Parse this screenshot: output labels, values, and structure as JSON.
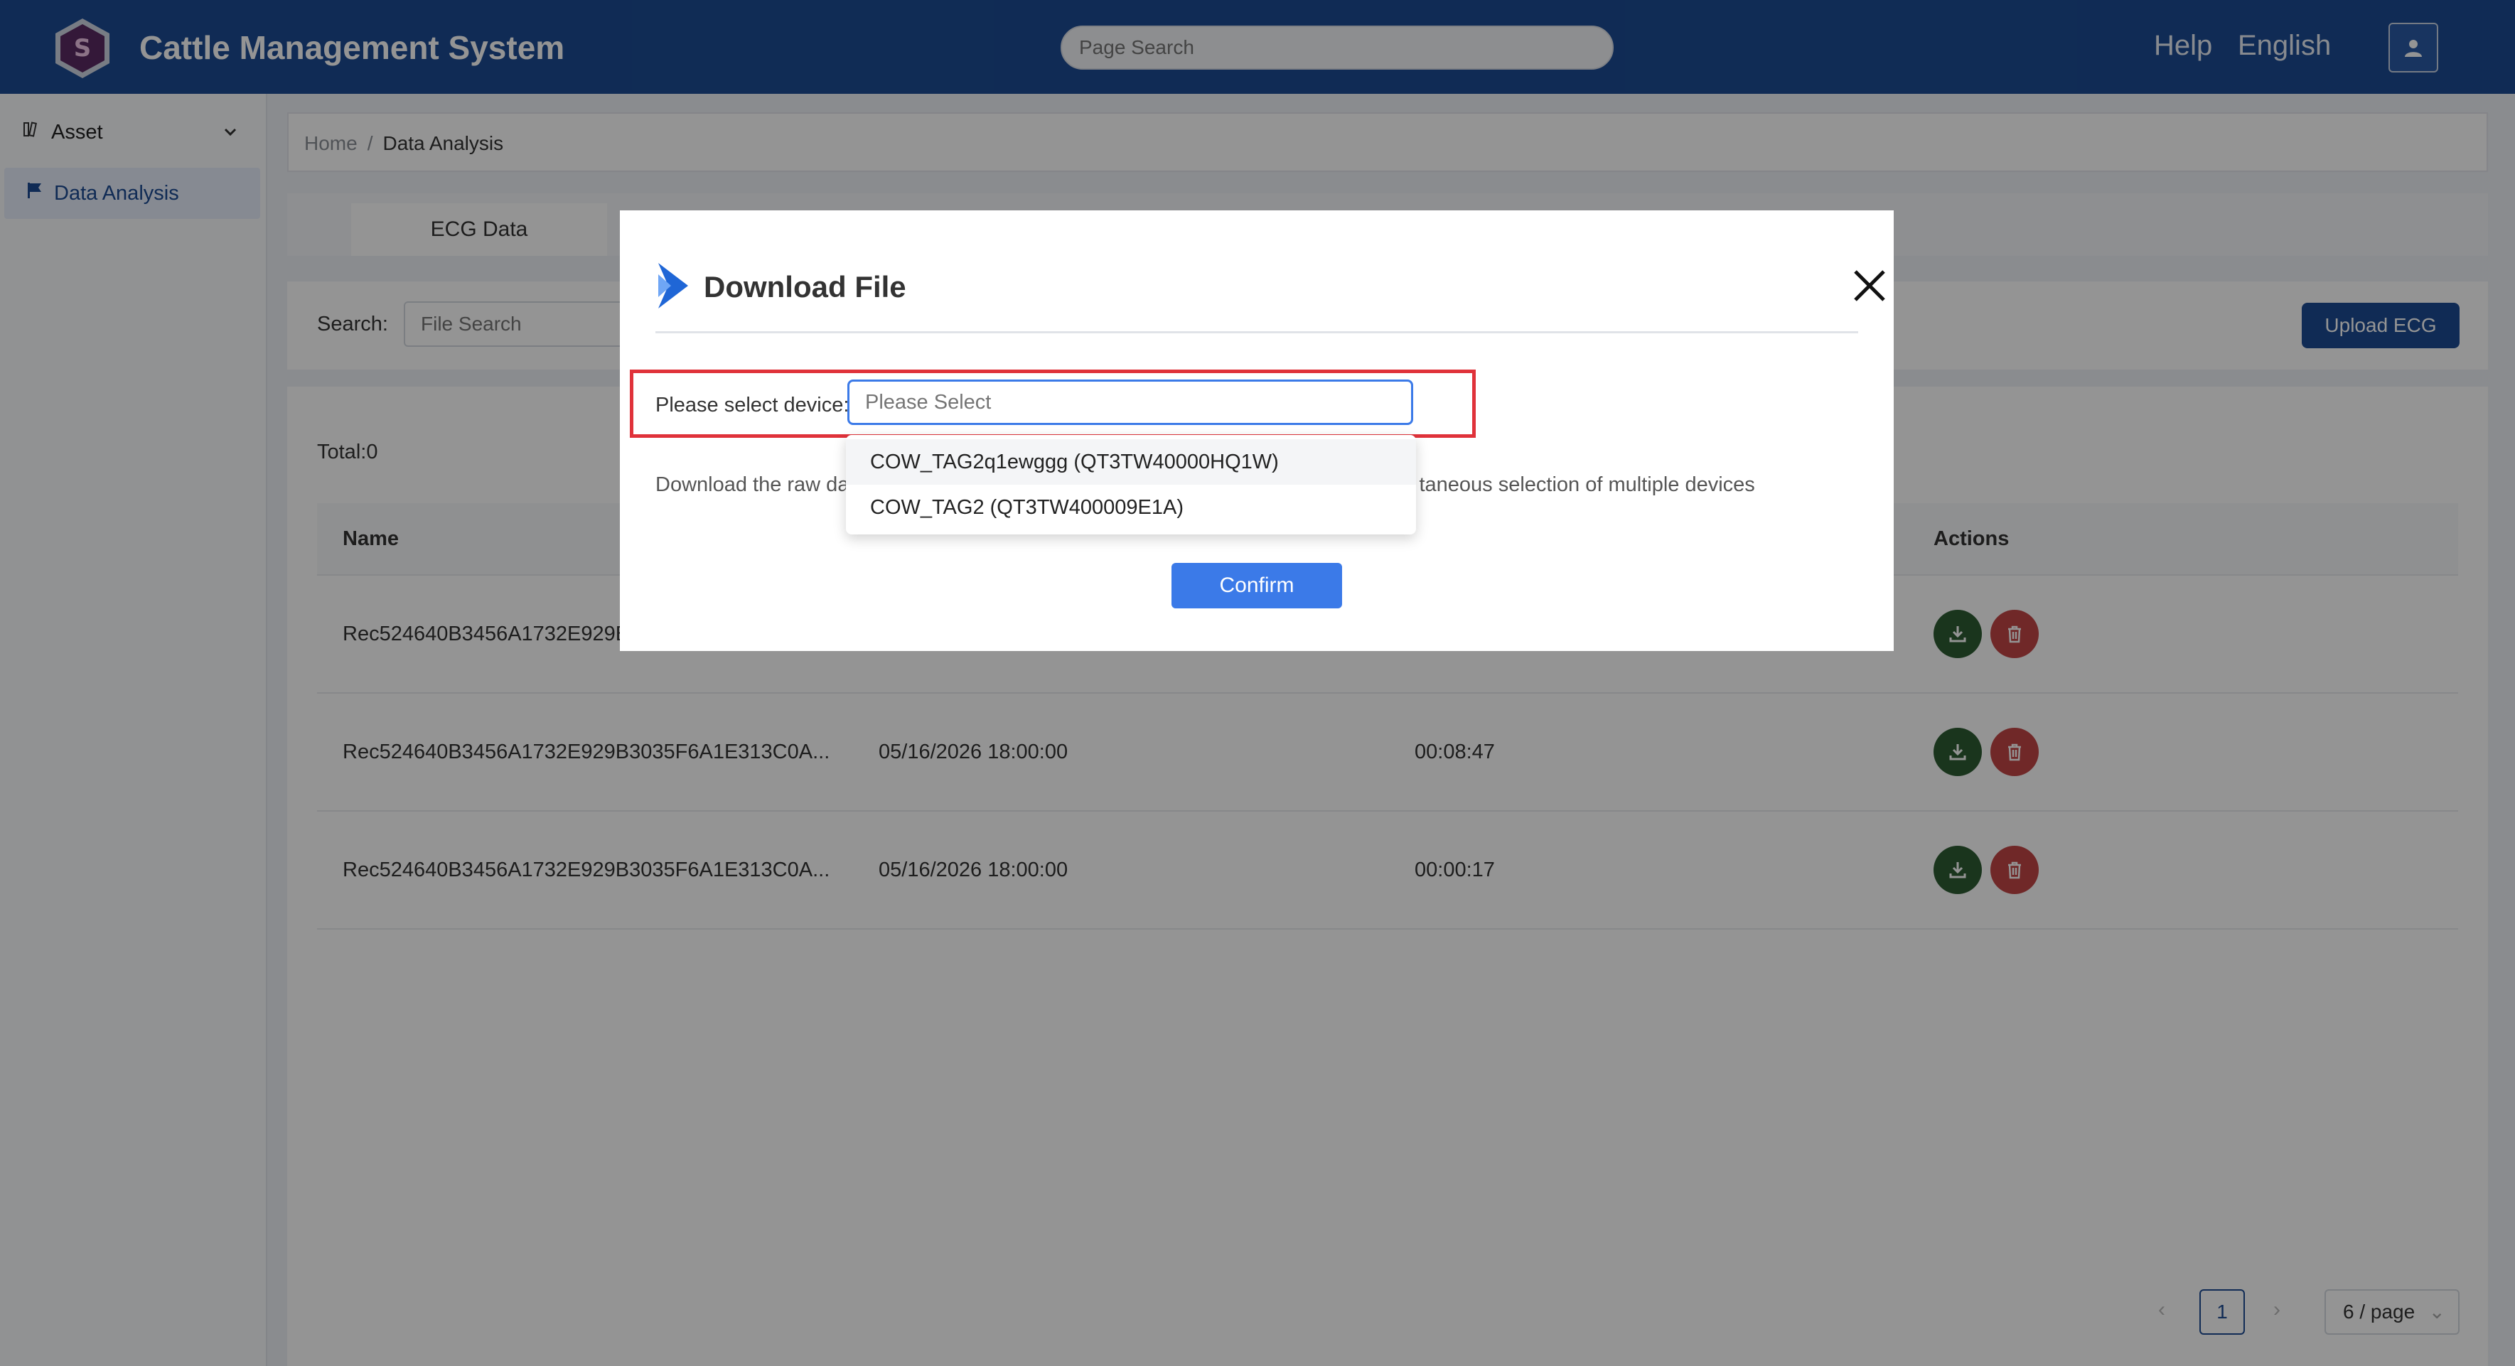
{
  "header": {
    "app_title": "Cattle Management System",
    "search_placeholder": "Page Search",
    "help_label": "Help",
    "language_label": "English"
  },
  "sidebar": {
    "items": [
      {
        "label": "Asset"
      },
      {
        "label": "Data Analysis"
      }
    ]
  },
  "breadcrumb": {
    "home": "Home",
    "separator": "/",
    "current": "Data Analysis"
  },
  "tabs": [
    {
      "label": "ECG Data"
    }
  ],
  "search": {
    "label": "Search:",
    "placeholder": "File Search",
    "upload_label": "Upload ECG"
  },
  "table": {
    "total_label": "Total:0",
    "columns": [
      "Name",
      "Actions"
    ],
    "rows": [
      {
        "name": "Rec524640B3456A1732E929B",
        "date": "",
        "duration": ""
      },
      {
        "name": "Rec524640B3456A1732E929B3035F6A1E313C0A...",
        "date": "05/16/2026 18:00:00",
        "duration": "00:08:47"
      },
      {
        "name": "Rec524640B3456A1732E929B3035F6A1E313C0A...",
        "date": "05/16/2026 18:00:00",
        "duration": "00:00:17"
      }
    ]
  },
  "pagination": {
    "current_page": "1",
    "page_size": "6 / page"
  },
  "modal": {
    "title": "Download File",
    "select_label": "Please select device:",
    "select_placeholder": "Please Select",
    "description_left": "Download the raw da",
    "description_right": "taneous selection of multiple devices",
    "confirm_label": "Confirm",
    "options": [
      {
        "label": "COW_TAG2q1ewggg (QT3TW40000HQ1W)"
      },
      {
        "label": "COW_TAG2 (QT3TW400009E1A)"
      }
    ]
  },
  "colors": {
    "header_bg": "#1c4b93",
    "primary": "#3b7ae8",
    "highlight_frame": "#e0323a",
    "download_action": "#2d5c33",
    "delete_action": "#c24545"
  }
}
